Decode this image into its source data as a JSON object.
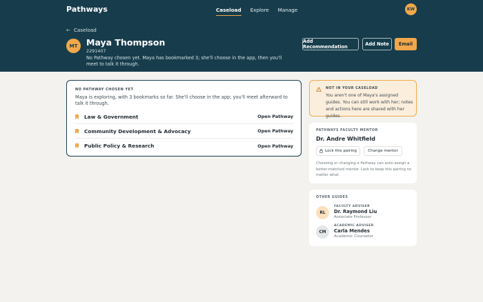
{
  "app": {
    "brand": "Pathways",
    "user_initials": "KW"
  },
  "nav": [
    {
      "label": "Caseload",
      "active": true
    },
    {
      "label": "Explore",
      "active": false
    },
    {
      "label": "Manage",
      "active": false
    }
  ],
  "header": {
    "back_label": "Caseload",
    "student": {
      "initials": "MT",
      "name": "Maya Thompson",
      "id": "2291407",
      "status": "No Pathway chosen yet. Maya has bookmarked 3; she'll choose in the app, then you'll meet to talk it through."
    },
    "actions": {
      "add_recommendation": "Add Recommendation",
      "add_note": "Add Note",
      "email": "Email"
    }
  },
  "main": {
    "eyebrow": "NO PATHWAY CHOSEN YET",
    "description": "Maya is exploring, with 3 bookmarks so far. She'll choose in the app; you'll meet afterward to talk it through.",
    "pathways": [
      {
        "label": "Law & Government",
        "action": "Open Pathway"
      },
      {
        "label": "Community Development & Advocacy",
        "action": "Open Pathway"
      },
      {
        "label": "Public Policy & Research",
        "action": "Open Pathway"
      }
    ]
  },
  "notice": {
    "eyebrow": "NOT IN YOUR CASELOAD",
    "text": "You aren't one of Maya's assigned guides. You can still work with her; notes and actions here are shared with her guides."
  },
  "mentor": {
    "eyebrow": "PATHWAYS FACULTY MENTOR",
    "name": "Dr. Andre Whitfield",
    "lock_label": "Lock this pairing",
    "change_label": "Change mentor",
    "note": "Choosing or changing a Pathway can auto-assign a better-matched mentor. Lock to keep this pairing no matter what."
  },
  "guides": {
    "eyebrow": "OTHER GUIDES",
    "items": [
      {
        "initials": "RL",
        "role": "FACULTY ADVISER",
        "name": "Dr. Raymond Liu",
        "title": "Associate Professor"
      },
      {
        "initials": "CM",
        "role": "ACADEMIC ADVISER",
        "name": "Carla Mendes",
        "title": "Academic Counselor"
      }
    ]
  },
  "colors": {
    "header_bg": "#173d4c",
    "accent": "#f2a84a",
    "page_bg": "#f3f2ef",
    "notice_bg": "#fbeedd"
  }
}
